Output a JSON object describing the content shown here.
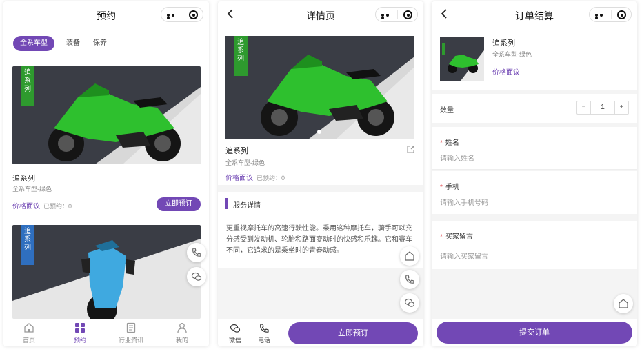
{
  "colors": {
    "accent": "#7248b5",
    "ribbon_green": "#2e9a2e",
    "ribbon_blue": "#2f6fbf",
    "required": "#e0484e"
  },
  "screen1": {
    "title": "预约",
    "tabs": [
      {
        "label": "全系车型",
        "active": true
      },
      {
        "label": "装备",
        "active": false
      },
      {
        "label": "保养",
        "active": false
      }
    ],
    "cards": [
      {
        "ribbon": [
          "追",
          "系",
          "列"
        ],
        "name": "追系列",
        "sub": "全系车型-绿色",
        "price_label": "价格面议",
        "booked": "已预约：0",
        "button": "立即预订"
      },
      {
        "ribbon": [
          "追",
          "系",
          "列"
        ]
      }
    ],
    "floating": [
      "phone-icon",
      "chat-icon"
    ],
    "tabbar": [
      {
        "label": "首页",
        "icon": "home-icon",
        "active": false
      },
      {
        "label": "预约",
        "icon": "grid-icon",
        "active": true
      },
      {
        "label": "行业资讯",
        "icon": "news-icon",
        "active": false
      },
      {
        "label": "我的",
        "icon": "user-icon",
        "active": false
      }
    ]
  },
  "screen2": {
    "title": "详情页",
    "ribbon": [
      "追",
      "系",
      "列"
    ],
    "name": "追系列",
    "sub": "全系车型-绿色",
    "price_label": "价格面议",
    "booked": "已预约：0",
    "section_title": "服务详情",
    "description": "更重视摩托车的高速行驶性能。乘用这种摩托车，骑手可以充分感受到发动机、轮胎和路面变动时的快感和乐趣。它和赛车不同，它追求的是乘坐时的青春动感。",
    "floating": [
      "home-icon",
      "phone-icon",
      "chat-icon"
    ],
    "bottom": {
      "wechat": "微信",
      "phone": "电话",
      "book": "立即预订"
    }
  },
  "screen3": {
    "title": "订单结算",
    "product": {
      "name": "追系列",
      "sub": "全系车型-绿色",
      "price_label": "价格面议"
    },
    "quantity_label": "数量",
    "quantity": "1",
    "minus": "−",
    "plus": "+",
    "required_mark": "*",
    "fields": [
      {
        "label": "姓名",
        "placeholder": "请输入姓名"
      },
      {
        "label": "手机",
        "placeholder": "请输入手机号码"
      },
      {
        "label": "买家留言",
        "placeholder": "请输入买家留言"
      }
    ],
    "submit": "提交订单"
  }
}
